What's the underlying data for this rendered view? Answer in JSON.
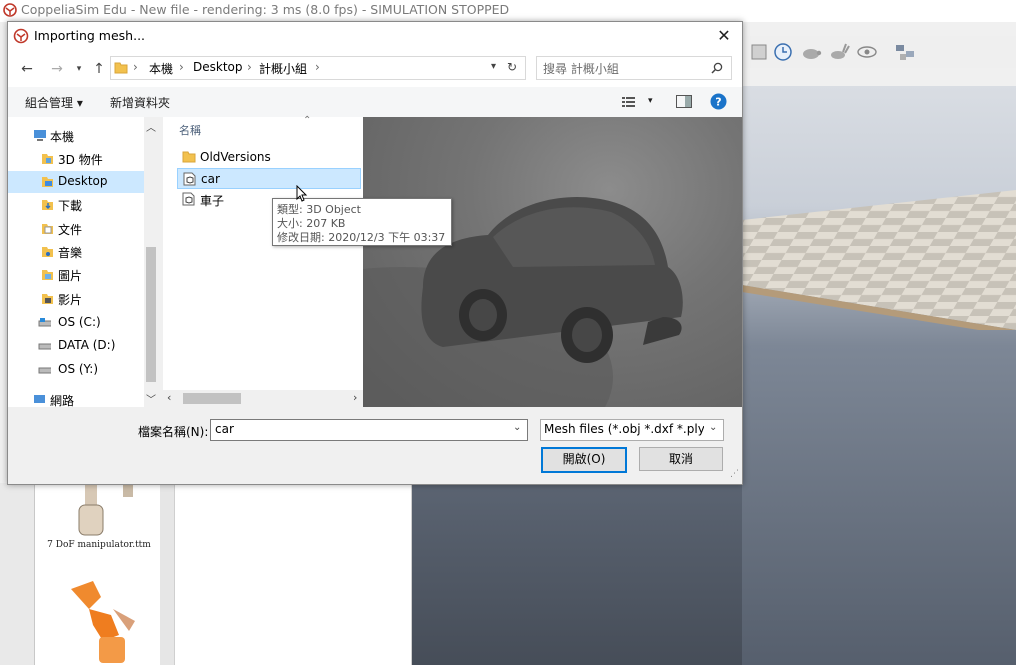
{
  "app": {
    "title": "CoppeliaSim Edu - New file - rendering: 3 ms (8.0 fps) - SIMULATION STOPPED"
  },
  "dialog": {
    "title": "Importing mesh...",
    "breadcrumb": [
      "本機",
      "Desktop",
      "計概小組"
    ],
    "search_placeholder": "搜尋 計概小組",
    "commands": {
      "organize": "組合管理 ▾",
      "new_folder": "新增資料夾"
    },
    "nav_items": [
      {
        "label": "本機",
        "icon": "computer-icon"
      },
      {
        "label": "3D 物件",
        "icon": "folder-3d-icon"
      },
      {
        "label": "Desktop",
        "icon": "desktop-folder-icon",
        "selected": true
      },
      {
        "label": "下載",
        "icon": "downloads-icon"
      },
      {
        "label": "文件",
        "icon": "documents-icon"
      },
      {
        "label": "音樂",
        "icon": "music-icon"
      },
      {
        "label": "圖片",
        "icon": "pictures-icon"
      },
      {
        "label": "影片",
        "icon": "videos-icon"
      },
      {
        "label": "OS (C:)",
        "icon": "drive-icon"
      },
      {
        "label": "DATA (D:)",
        "icon": "drive-icon"
      },
      {
        "label": "OS (Y:)",
        "icon": "drive-icon"
      },
      {
        "label": "網路",
        "icon": "network-icon"
      }
    ],
    "file_list": {
      "column_header": "名稱",
      "items": [
        {
          "name": "OldVersions",
          "icon": "folder-icon"
        },
        {
          "name": "car",
          "icon": "3d-object-file-icon",
          "selected": true
        },
        {
          "name": "車子",
          "icon": "3d-object-file-icon"
        }
      ]
    },
    "tooltip": {
      "type": "類型: 3D Object",
      "size": "大小: 207 KB",
      "modified": "修改日期: 2020/12/3 下午 03:37"
    },
    "filename_label": "檔案名稱(N):",
    "filename_value": "car",
    "filetype_value": "Mesh files (*.obj *.dxf *.ply *.st",
    "open_button": "開啟(O)",
    "cancel_button": "取消"
  },
  "model_browser": {
    "item_label": "7 DoF manipulator.ttm"
  }
}
